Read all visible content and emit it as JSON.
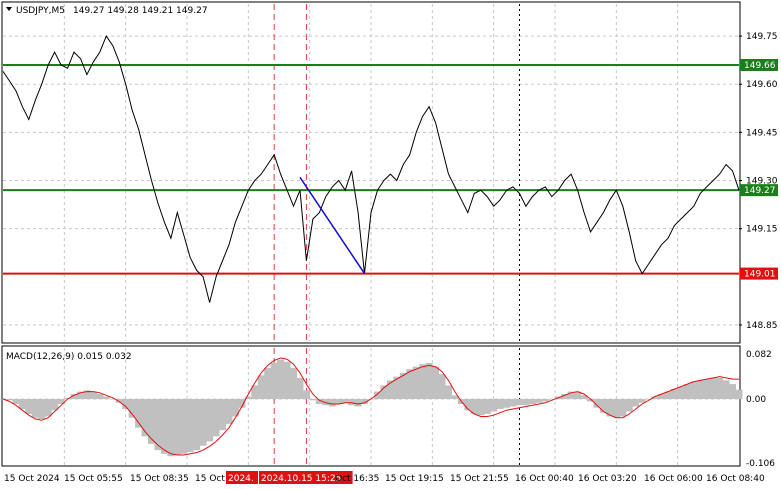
{
  "header": {
    "symbol": "USDJPY,M5",
    "ohlc": "149.27 149.28 149.21 149.27"
  },
  "colors": {
    "price_line": "#000000",
    "green_level": "#1a7f1a",
    "red_level": "#e01010",
    "trend_line": "#1010d0",
    "vline_red": "#e04040",
    "macd_hist": "#c0c0c0",
    "macd_signal": "#e01010",
    "grid": "#c8c8c8"
  },
  "chart_data": [
    {
      "type": "line",
      "title": "USDJPY,M5",
      "ylim": [
        148.8,
        149.85
      ],
      "price_ticks": [
        "149.75",
        "149.60",
        "149.45",
        "149.30",
        "149.15",
        "148.85"
      ],
      "levels": [
        {
          "value": 149.66,
          "label": "149.66",
          "color": "green"
        },
        {
          "value": 149.27,
          "label": "149.27",
          "color": "green"
        },
        {
          "value": 149.01,
          "label": "149.01",
          "color": "red"
        }
      ],
      "trendline": {
        "from_index": 46,
        "from_value": 149.31,
        "to_index": 56,
        "to_value": 149.01
      },
      "series": [
        {
          "values": [
            149.64,
            149.61,
            149.58,
            149.53,
            149.49,
            149.55,
            149.6,
            149.66,
            149.7,
            149.66,
            149.65,
            149.7,
            149.68,
            149.63,
            149.67,
            149.7,
            149.75,
            149.72,
            149.67,
            149.6,
            149.52,
            149.46,
            149.38,
            149.3,
            149.23,
            149.17,
            149.12,
            149.2,
            149.13,
            149.06,
            149.02,
            149.0,
            148.92,
            149.0,
            149.05,
            149.1,
            149.17,
            149.22,
            149.27,
            149.3,
            149.32,
            149.35,
            149.38,
            149.32,
            149.27,
            149.22,
            149.27,
            149.05,
            149.18,
            149.2,
            149.25,
            149.28,
            149.3,
            149.27,
            149.33,
            149.2,
            149.01,
            149.2,
            149.27,
            149.3,
            149.32,
            149.3,
            149.35,
            149.38,
            149.45,
            149.5,
            149.53,
            149.48,
            149.4,
            149.32,
            149.28,
            149.24,
            149.2,
            149.26,
            149.27,
            149.25,
            149.22,
            149.24,
            149.27,
            149.28,
            149.26,
            149.22,
            149.25,
            149.27,
            149.28,
            149.25,
            149.27,
            149.3,
            149.32,
            149.27,
            149.2,
            149.14,
            149.17,
            149.2,
            149.24,
            149.27,
            149.22,
            149.14,
            149.05,
            149.01,
            149.04,
            149.07,
            149.1,
            149.12,
            149.16,
            149.18,
            149.2,
            149.22,
            149.26,
            149.28,
            149.3,
            149.32,
            149.35,
            149.33,
            149.27
          ]
        }
      ],
      "vlines": [
        {
          "index": 42
        },
        {
          "index": 47
        }
      ],
      "vline_black": {
        "index": 80
      }
    },
    {
      "type": "bar",
      "title": "MACD(12,26,9) 0.015 0.032",
      "ylim": [
        -0.106,
        0.082
      ],
      "ticks": [
        "0.082",
        "0.00",
        "-0.106"
      ],
      "histogram": [
        0.0,
        -0.002,
        -0.008,
        -0.016,
        -0.024,
        -0.03,
        -0.032,
        -0.028,
        -0.018,
        -0.008,
        0.002,
        0.008,
        0.012,
        0.014,
        0.012,
        0.008,
        0.004,
        0.0,
        -0.006,
        -0.016,
        -0.03,
        -0.046,
        -0.06,
        -0.072,
        -0.082,
        -0.088,
        -0.092,
        -0.09,
        -0.088,
        -0.085,
        -0.082,
        -0.075,
        -0.068,
        -0.06,
        -0.05,
        -0.04,
        -0.028,
        -0.014,
        0.004,
        0.022,
        0.038,
        0.05,
        0.058,
        0.063,
        0.06,
        0.05,
        0.034,
        0.014,
        -0.002,
        -0.008,
        -0.01,
        -0.012,
        -0.008,
        -0.006,
        -0.01,
        -0.012,
        -0.008,
        0.0,
        0.012,
        0.022,
        0.03,
        0.036,
        0.042,
        0.048,
        0.052,
        0.056,
        0.058,
        0.052,
        0.04,
        0.022,
        0.006,
        -0.008,
        -0.018,
        -0.024,
        -0.026,
        -0.024,
        -0.02,
        -0.016,
        -0.014,
        -0.012,
        -0.01,
        -0.01,
        -0.008,
        -0.006,
        -0.004,
        0.0,
        0.004,
        0.008,
        0.012,
        0.012,
        0.006,
        -0.004,
        -0.014,
        -0.022,
        -0.028,
        -0.03,
        -0.028,
        -0.02,
        -0.012,
        -0.006,
        0.0,
        0.004,
        0.008,
        0.012,
        0.016,
        0.02,
        0.024,
        0.028,
        0.03,
        0.032,
        0.034,
        0.034,
        0.03,
        0.024,
        0.015
      ],
      "signal": [
        0.0,
        -0.004,
        -0.01,
        -0.018,
        -0.026,
        -0.032,
        -0.034,
        -0.03,
        -0.02,
        -0.01,
        0.0,
        0.006,
        0.01,
        0.012,
        0.012,
        0.01,
        0.006,
        0.002,
        -0.004,
        -0.012,
        -0.024,
        -0.038,
        -0.052,
        -0.064,
        -0.074,
        -0.082,
        -0.088,
        -0.09,
        -0.09,
        -0.088,
        -0.086,
        -0.082,
        -0.076,
        -0.068,
        -0.058,
        -0.046,
        -0.03,
        -0.012,
        0.008,
        0.026,
        0.042,
        0.054,
        0.062,
        0.066,
        0.064,
        0.056,
        0.042,
        0.024,
        0.008,
        -0.002,
        -0.006,
        -0.008,
        -0.008,
        -0.006,
        -0.006,
        -0.008,
        -0.006,
        0.0,
        0.008,
        0.018,
        0.026,
        0.032,
        0.038,
        0.044,
        0.048,
        0.052,
        0.054,
        0.052,
        0.044,
        0.03,
        0.012,
        -0.004,
        -0.016,
        -0.024,
        -0.028,
        -0.028,
        -0.026,
        -0.022,
        -0.018,
        -0.016,
        -0.014,
        -0.012,
        -0.01,
        -0.008,
        -0.006,
        -0.002,
        0.002,
        0.006,
        0.01,
        0.012,
        0.008,
        0.0,
        -0.01,
        -0.02,
        -0.026,
        -0.03,
        -0.03,
        -0.024,
        -0.016,
        -0.008,
        -0.002,
        0.004,
        0.008,
        0.012,
        0.016,
        0.02,
        0.024,
        0.028,
        0.03,
        0.032,
        0.034,
        0.036,
        0.034,
        0.032,
        0.032
      ]
    }
  ],
  "time_axis": {
    "labels": [
      "15 Oct 2024",
      "15 Oct 05:55",
      "15 Oct 08:35",
      "15 Oct",
      "2024.",
      "2024.10.15 15:25",
      "Oct 16:35",
      "15 Oct 19:15",
      "15 Oct 21:55",
      "16 Oct 00:40",
      "16 Oct 03:20",
      "16 Oct 06:00",
      "16 Oct 08:40"
    ],
    "highlight": [
      "2024.",
      "2024.10.15 15:25"
    ]
  }
}
